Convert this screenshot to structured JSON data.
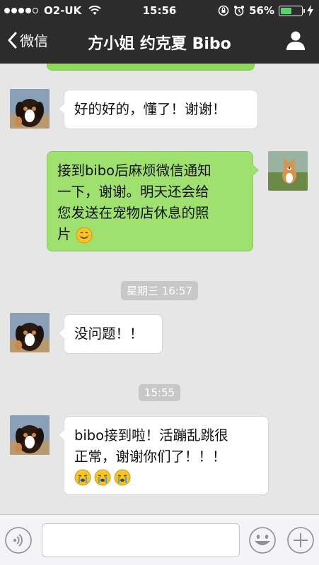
{
  "status_bar": {
    "carrier": "O2-UK",
    "time": "15:56",
    "battery_percent": "56%",
    "battery_level": 0.56,
    "battery_color": "#4cd964"
  },
  "nav": {
    "back_label": "微信",
    "title": "方小姐 约克夏 Bibo",
    "back_icon": "chevron-left-icon",
    "contact_icon": "person-icon"
  },
  "messages": [
    {
      "direction": "in",
      "text": "好的好的，懂了！谢谢！"
    },
    {
      "direction": "out",
      "lines": [
        "接到bibo后麻烦微信通知",
        "一下，谢谢。明天还会给",
        "您发送在宠物店休息的照",
        "片"
      ],
      "emoji": "smile-emoji"
    },
    {
      "type": "timestamp",
      "text": "星期三 16:57"
    },
    {
      "direction": "in",
      "text": "没问题！！"
    },
    {
      "type": "timestamp",
      "text": "15:55"
    },
    {
      "direction": "in",
      "lines": [
        "bibo接到啦！活蹦乱跳很",
        "正常，谢谢你们了！！！"
      ],
      "emoji_row": [
        "crying-emoji",
        "crying-emoji",
        "crying-emoji"
      ]
    }
  ],
  "input_bar": {
    "voice_icon": "voice-icon",
    "emoji_icon": "emoji-face-icon",
    "plus_icon": "plus-icon",
    "input_value": ""
  },
  "colors": {
    "header": "#2c2c2c",
    "chat_bg": "#e6e6e6",
    "bubble_out": "#9fe16f",
    "bubble_in": "#ffffff"
  }
}
